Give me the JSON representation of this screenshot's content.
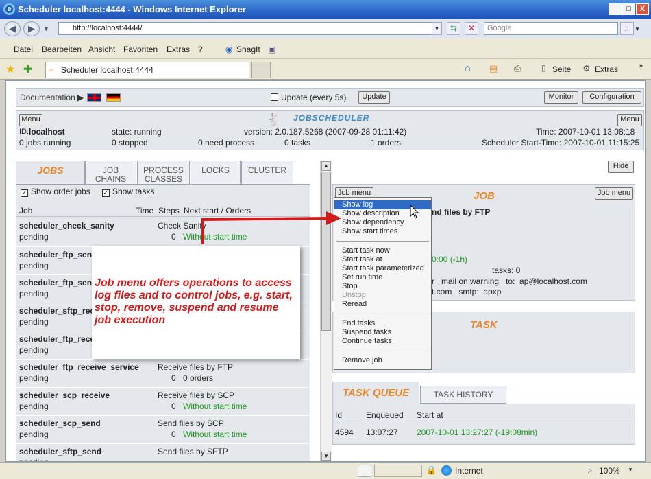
{
  "window": {
    "title": "Scheduler localhost:4444 - Windows Internet Explorer",
    "min": "_",
    "max": "□",
    "close": "X"
  },
  "address": {
    "url": "http://localhost:4444/",
    "search_placeholder": "Google"
  },
  "menubar": [
    "Datei",
    "Bearbeiten",
    "Ansicht",
    "Favoriten",
    "Extras",
    "?"
  ],
  "snagit": "SnagIt",
  "tab": {
    "title": "Scheduler localhost:4444"
  },
  "toolbar": {
    "seite": "Seite",
    "extras": "Extras"
  },
  "docbar": {
    "documentation": "Documentation ▶",
    "update_label": "Update (every 5s)",
    "update_btn": "Update",
    "monitor_btn": "Monitor",
    "config_btn": "Configuration"
  },
  "header": {
    "menu_left": "Menu",
    "menu_right": "Menu",
    "logo": "JOBSCHEDULER",
    "id_label": "ID:",
    "id_value": "localhost",
    "state": "state: running",
    "version": "version:  2.0.187.5268 (2007-09-28 01:11:42)",
    "time": "Time:  2007-10-01 13:08:18",
    "jobs_running": "0 jobs running",
    "stopped": "0 stopped",
    "need_process": "0 need process",
    "tasks": "0 tasks",
    "orders": "1 orders",
    "start_time": "Scheduler Start-Time:  2007-10-01 11:15:25"
  },
  "left_tabs": {
    "jobs": "JOBS",
    "job_chains_1": "JOB",
    "job_chains_2": "CHAINS",
    "process_1": "PROCESS",
    "process_2": "CLASSES",
    "locks": "LOCKS",
    "cluster": "CLUSTER"
  },
  "options": {
    "show_order_jobs": "Show order jobs",
    "show_tasks": "Show tasks"
  },
  "columns": {
    "job": "Job",
    "time": "Time",
    "steps": "Steps",
    "next": "Next start / Orders"
  },
  "jobs": [
    {
      "name": "scheduler_check_sanity",
      "desc": "Check Sanity",
      "state": "pending",
      "steps": "0",
      "next": "Without start time"
    },
    {
      "name": "scheduler_ftp_send",
      "desc": "",
      "state": "pending",
      "steps": "",
      "next": ""
    },
    {
      "name": "scheduler_ftp_send",
      "desc": "",
      "state": "pending",
      "steps": "",
      "next": ""
    },
    {
      "name": "scheduler_sftp_rec",
      "desc": "",
      "state": "pending",
      "steps": "",
      "next": ""
    },
    {
      "name": "scheduler_ftp_rece",
      "desc": "",
      "state": "pending",
      "steps": "",
      "next": ""
    },
    {
      "name": "scheduler_ftp_receive_service",
      "desc": "Receive files by FTP",
      "state": "pending",
      "steps": "0",
      "next": "0 orders"
    },
    {
      "name": "scheduler_scp_receive",
      "desc": "Receive files by SCP",
      "state": "pending",
      "steps": "0",
      "next": "Without start time"
    },
    {
      "name": "scheduler_scp_send",
      "desc": "Send files by SCP",
      "state": "pending",
      "steps": "0",
      "next": "Without start time"
    },
    {
      "name": "scheduler_sftp_send",
      "desc": "Send files by SFTP",
      "state": "pending",
      "steps": "0",
      "next": "Without start time"
    }
  ],
  "right": {
    "hide_btn": "Hide",
    "job_menu_left": "Job menu",
    "job_menu_right": "Job menu",
    "job_title": "JOB",
    "job_desc": "nd files by FTP",
    "start_time_frag": "0:00  (-1h)",
    "tasks": "tasks:  0",
    "mail_frag_1": "r   mail on warning   to:  ap@localhost.com",
    "mail_frag_2": "t.com   smtp:  apxp",
    "task_title": "TASK",
    "task_queue": "TASK QUEUE",
    "task_history": "TASK HISTORY",
    "queue_cols": {
      "id": "Id",
      "enqueued": "Enqueued",
      "start": "Start at"
    },
    "queue_row": {
      "id": "4594",
      "enqueued": "13:07:27",
      "start": "2007-10-01 13:27:27  (-19:08min)"
    }
  },
  "popup": {
    "items": [
      "Show log",
      "Show description",
      "Show dependency",
      "Show start times",
      "Start task now",
      "Start task at",
      "Start task parameterized",
      "Set run time",
      "Stop",
      "Unstop",
      "Reread",
      "End tasks",
      "Suspend tasks",
      "Continue tasks",
      "Remove job"
    ]
  },
  "callout": "Job menu offers operations to access log files and to control jobs, e.g. start, stop, remove, suspend and resume job execution",
  "statusbar": {
    "zone": "Internet",
    "zoom": "100%"
  },
  "colors": {
    "accent": "#e8862a",
    "green": "#1a9a1a",
    "callout_red": "#d11a1a",
    "highlight": "#316ac5"
  }
}
